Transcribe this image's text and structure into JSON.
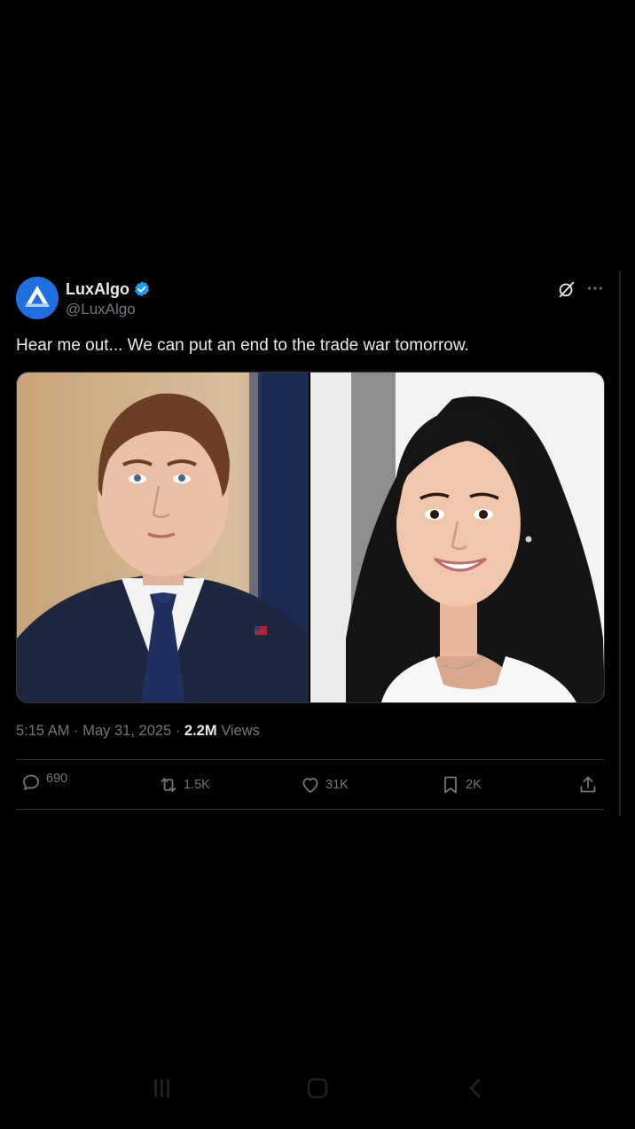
{
  "tweet": {
    "display_name": "LuxAlgo",
    "handle": "@LuxAlgo",
    "text": "Hear me out... We can put an end to the trade war tomorrow.",
    "time": "5:15 AM",
    "date": "May 31, 2025",
    "views_count": "2.2M",
    "views_label": "Views",
    "separator": "·",
    "media": [
      {
        "description": "young man in dark suit with blue tie and flag pin"
      },
      {
        "description": "young woman with long dark hair in white top smiling"
      }
    ]
  },
  "actions": {
    "replies": "690",
    "reposts": "1.5K",
    "likes": "31K",
    "bookmarks": "2K"
  },
  "icons": {
    "avatar": "luxalgo-logo",
    "verified": "verified-badge-icon",
    "grok": "grok-icon",
    "more": "more-icon",
    "reply": "reply-icon",
    "repost": "repost-icon",
    "like": "heart-icon",
    "bookmark": "bookmark-icon",
    "share": "share-icon"
  },
  "colors": {
    "background": "#000000",
    "text": "#e7e9ea",
    "secondary": "#71767b",
    "verified": "#1d9bf0",
    "avatar": "#1f6fe0"
  }
}
